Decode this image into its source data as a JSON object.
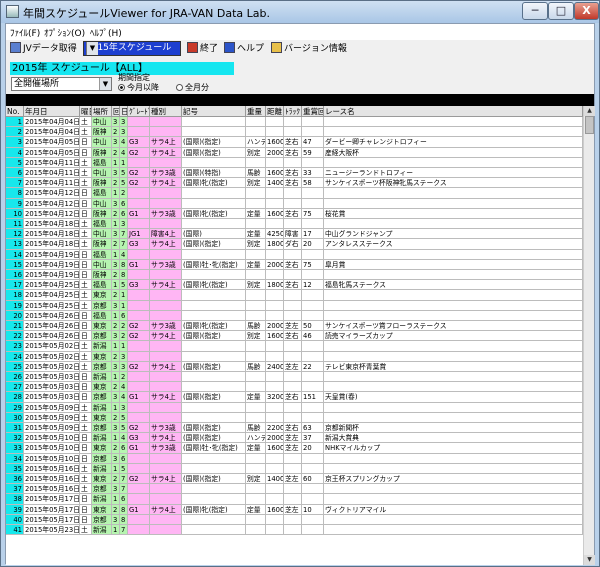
{
  "window": {
    "title": "年間スケジュールViewer for JRA-VAN Data Lab."
  },
  "caption_buttons": {
    "minimize": "─",
    "maximize": "□",
    "close": "X"
  },
  "menu": [
    "ﾌｧｲﾙ(F)",
    "ｵﾌﾟｼｮﾝ(O)",
    "ﾍﾙﾌﾟ(H)"
  ],
  "toolbar": {
    "fetch_label": "JVデータ取得",
    "schedule_value": "2015年スケジュール",
    "end_label": "終了",
    "help_label": "ヘルプ",
    "version_label": "バージョン情報"
  },
  "heading": "2015年 スケジュール【ALL】",
  "filters": {
    "venue_value": "全開催場所",
    "period_label": "期間指定",
    "period_opt1": "今月以降",
    "period_opt2": "全月分"
  },
  "columns": [
    "No.",
    "年月日",
    "曜日",
    "場所",
    "回",
    "日",
    "ｸﾞﾚｰﾄﾞ",
    "種別",
    "記号",
    "重量",
    "距離",
    "ﾄﾗｯｸ",
    "重賞回",
    "レース名"
  ],
  "rows": [
    [
      "1",
      "2015年04月04日",
      "土",
      "中山",
      "3",
      "3",
      "",
      "",
      "",
      "",
      "",
      "",
      "",
      ""
    ],
    [
      "2",
      "2015年04月04日",
      "土",
      "阪神",
      "2",
      "3",
      "",
      "",
      "",
      "",
      "",
      "",
      "",
      ""
    ],
    [
      "3",
      "2015年04月05日",
      "日",
      "中山",
      "3",
      "4",
      "G3",
      "サラ4上",
      "(国際)(指定)",
      "ハンデ",
      "1600",
      "芝右",
      "47",
      "ダービー卿チャレンジトロフィー"
    ],
    [
      "4",
      "2015年04月05日",
      "日",
      "阪神",
      "2",
      "4",
      "G2",
      "サラ4上",
      "(国際)(指定)",
      "別定",
      "2000",
      "芝右",
      "59",
      "産経大阪杯"
    ],
    [
      "5",
      "2015年04月11日",
      "土",
      "福島",
      "1",
      "1",
      "",
      "",
      "",
      "",
      "",
      "",
      "",
      ""
    ],
    [
      "6",
      "2015年04月11日",
      "土",
      "中山",
      "3",
      "5",
      "G2",
      "サラ3歳",
      "(国際)(特指)",
      "馬齢",
      "1600",
      "芝右",
      "33",
      "ニュージーランドトロフィー"
    ],
    [
      "7",
      "2015年04月11日",
      "土",
      "阪神",
      "2",
      "5",
      "G2",
      "サラ4上",
      "(国際)牝(指定)",
      "別定",
      "1400",
      "芝右",
      "58",
      "サンケイスポーツ杯阪神牝馬ステークス"
    ],
    [
      "8",
      "2015年04月12日",
      "日",
      "福島",
      "1",
      "2",
      "",
      "",
      "",
      "",
      "",
      "",
      "",
      ""
    ],
    [
      "9",
      "2015年04月12日",
      "日",
      "中山",
      "3",
      "6",
      "",
      "",
      "",
      "",
      "",
      "",
      "",
      ""
    ],
    [
      "10",
      "2015年04月12日",
      "日",
      "阪神",
      "2",
      "6",
      "G1",
      "サラ3歳",
      "(国際)牝(指定)",
      "定量",
      "1600",
      "芝右",
      "75",
      "桜花賞"
    ],
    [
      "11",
      "2015年04月18日",
      "土",
      "福島",
      "1",
      "3",
      "",
      "",
      "",
      "",
      "",
      "",
      "",
      ""
    ],
    [
      "12",
      "2015年04月18日",
      "土",
      "中山",
      "3",
      "7",
      "JG1",
      "障害4上",
      "(国際)",
      "定量",
      "4250",
      "障害",
      "17",
      "中山グランドジャンプ"
    ],
    [
      "13",
      "2015年04月18日",
      "土",
      "阪神",
      "2",
      "7",
      "G3",
      "サラ4上",
      "(国際)(指定)",
      "別定",
      "1800",
      "ダ右",
      "20",
      "アンタレスステークス"
    ],
    [
      "14",
      "2015年04月19日",
      "日",
      "福島",
      "1",
      "4",
      "",
      "",
      "",
      "",
      "",
      "",
      "",
      ""
    ],
    [
      "15",
      "2015年04月19日",
      "日",
      "中山",
      "3",
      "8",
      "G1",
      "サラ3歳",
      "(国際)牡･牝(指定)",
      "定量",
      "2000",
      "芝右",
      "75",
      "皐月賞"
    ],
    [
      "16",
      "2015年04月19日",
      "日",
      "阪神",
      "2",
      "8",
      "",
      "",
      "",
      "",
      "",
      "",
      "",
      ""
    ],
    [
      "17",
      "2015年04月25日",
      "土",
      "福島",
      "1",
      "5",
      "G3",
      "サラ4上",
      "(国際)牝(指定)",
      "別定",
      "1800",
      "芝右",
      "12",
      "福島牝馬ステークス"
    ],
    [
      "18",
      "2015年04月25日",
      "土",
      "東京",
      "2",
      "1",
      "",
      "",
      "",
      "",
      "",
      "",
      "",
      ""
    ],
    [
      "19",
      "2015年04月25日",
      "土",
      "京都",
      "3",
      "1",
      "",
      "",
      "",
      "",
      "",
      "",
      "",
      ""
    ],
    [
      "20",
      "2015年04月26日",
      "日",
      "福島",
      "1",
      "6",
      "",
      "",
      "",
      "",
      "",
      "",
      "",
      ""
    ],
    [
      "21",
      "2015年04月26日",
      "日",
      "東京",
      "2",
      "2",
      "G2",
      "サラ3歳",
      "(国際)牝(指定)",
      "馬齢",
      "2000",
      "芝左",
      "50",
      "サンケイスポーツ賞フローラステークス"
    ],
    [
      "22",
      "2015年04月26日",
      "日",
      "京都",
      "3",
      "2",
      "G2",
      "サラ4上",
      "(国際)(指定)",
      "別定",
      "1600",
      "芝右",
      "46",
      "読売マイラーズカップ"
    ],
    [
      "23",
      "2015年05月02日",
      "土",
      "新潟",
      "1",
      "1",
      "",
      "",
      "",
      "",
      "",
      "",
      "",
      ""
    ],
    [
      "24",
      "2015年05月02日",
      "土",
      "東京",
      "2",
      "3",
      "",
      "",
      "",
      "",
      "",
      "",
      "",
      ""
    ],
    [
      "25",
      "2015年05月02日",
      "土",
      "京都",
      "3",
      "3",
      "G2",
      "サラ4上",
      "(国際)(指定)",
      "馬齢",
      "2400",
      "芝左",
      "22",
      "テレビ東京杯青葉賞"
    ],
    [
      "26",
      "2015年05月03日",
      "日",
      "新潟",
      "1",
      "2",
      "",
      "",
      "",
      "",
      "",
      "",
      "",
      ""
    ],
    [
      "27",
      "2015年05月03日",
      "日",
      "東京",
      "2",
      "4",
      "",
      "",
      "",
      "",
      "",
      "",
      "",
      ""
    ],
    [
      "28",
      "2015年05月03日",
      "日",
      "京都",
      "3",
      "4",
      "G1",
      "サラ4上",
      "(国際)(指定)",
      "定量",
      "3200",
      "芝右",
      "151",
      "天皇賞(春)"
    ],
    [
      "29",
      "2015年05月09日",
      "土",
      "新潟",
      "1",
      "3",
      "",
      "",
      "",
      "",
      "",
      "",
      "",
      ""
    ],
    [
      "30",
      "2015年05月09日",
      "土",
      "東京",
      "2",
      "5",
      "",
      "",
      "",
      "",
      "",
      "",
      "",
      ""
    ],
    [
      "31",
      "2015年05月09日",
      "土",
      "京都",
      "3",
      "5",
      "G2",
      "サラ3歳",
      "(国際)(指定)",
      "馬齢",
      "2200",
      "芝右",
      "63",
      "京都新聞杯"
    ],
    [
      "32",
      "2015年05月10日",
      "日",
      "新潟",
      "1",
      "4",
      "G3",
      "サラ4上",
      "(国際)(指定)",
      "ハンデ",
      "2000",
      "芝左",
      "37",
      "新潟大賞典"
    ],
    [
      "33",
      "2015年05月10日",
      "日",
      "東京",
      "2",
      "6",
      "G1",
      "サラ3歳",
      "(国際)牡･牝(指定)",
      "定量",
      "1600",
      "芝左",
      "20",
      "NHKマイルカップ"
    ],
    [
      "34",
      "2015年05月10日",
      "日",
      "京都",
      "3",
      "6",
      "",
      "",
      "",
      "",
      "",
      "",
      "",
      ""
    ],
    [
      "35",
      "2015年05月16日",
      "土",
      "新潟",
      "1",
      "5",
      "",
      "",
      "",
      "",
      "",
      "",
      "",
      ""
    ],
    [
      "36",
      "2015年05月16日",
      "土",
      "東京",
      "2",
      "7",
      "G2",
      "サラ4上",
      "(国際)(指定)",
      "別定",
      "1400",
      "芝左",
      "60",
      "京王杯スプリングカップ"
    ],
    [
      "37",
      "2015年05月16日",
      "土",
      "京都",
      "3",
      "7",
      "",
      "",
      "",
      "",
      "",
      "",
      "",
      ""
    ],
    [
      "38",
      "2015年05月17日",
      "日",
      "新潟",
      "1",
      "6",
      "",
      "",
      "",
      "",
      "",
      "",
      "",
      ""
    ],
    [
      "39",
      "2015年05月17日",
      "日",
      "東京",
      "2",
      "8",
      "G1",
      "サラ4上",
      "(国際)牝(指定)",
      "定量",
      "1600",
      "芝左",
      "10",
      "ヴィクトリアマイル"
    ],
    [
      "40",
      "2015年05月17日",
      "日",
      "京都",
      "3",
      "8",
      "",
      "",
      "",
      "",
      "",
      "",
      "",
      ""
    ],
    [
      "41",
      "2015年05月23日",
      "土",
      "新潟",
      "1",
      "7",
      "",
      "",
      "",
      "",
      "",
      "",
      "",
      ""
    ]
  ]
}
